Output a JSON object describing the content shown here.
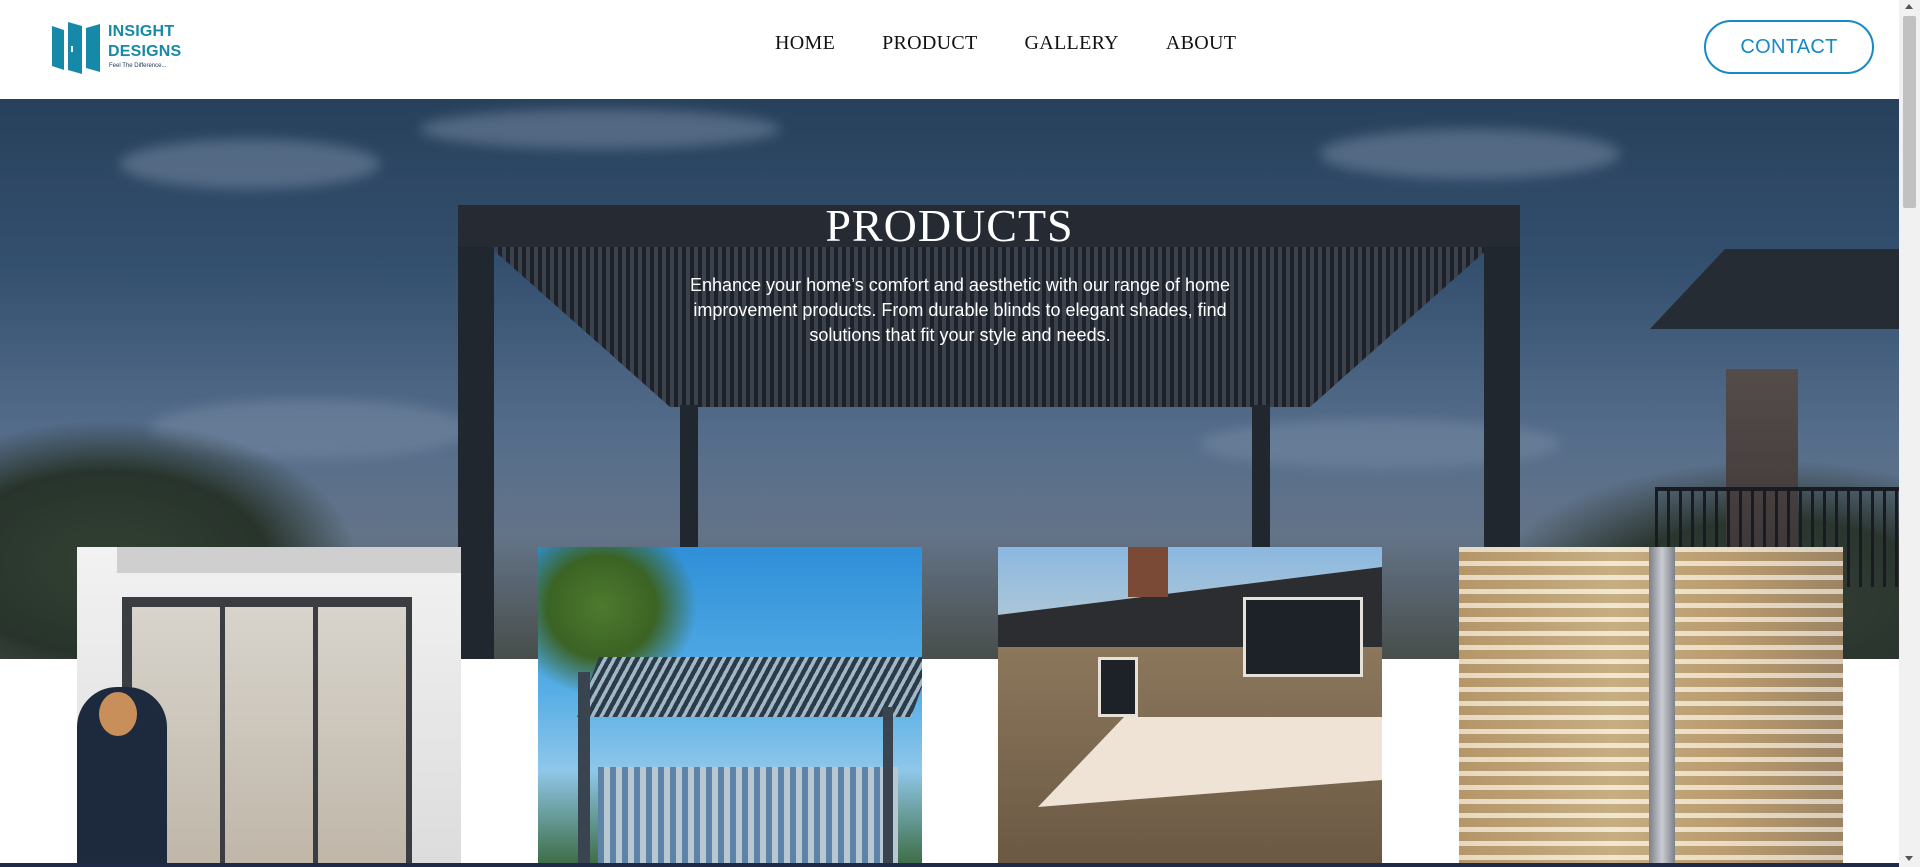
{
  "header": {
    "logo": {
      "line1": "INSIGHT",
      "line2": "DESIGNS",
      "tagline": "Feel The Difference..."
    },
    "nav": [
      {
        "label": "HOME"
      },
      {
        "label": "PRODUCT"
      },
      {
        "label": "GALLERY"
      },
      {
        "label": "ABOUT"
      }
    ],
    "contact_label": "CONTACT"
  },
  "hero": {
    "title": "PRODUCTS",
    "description": "Enhance your home’s comfort and aesthetic with our range of home improvement products. From durable blinds to elegant shades, find solutions that fit your style and needs."
  },
  "products": [
    {
      "image": "sliding-door-screen-image"
    },
    {
      "image": "louvred-pergola-image"
    },
    {
      "image": "retractable-awning-image"
    },
    {
      "image": "venetian-blinds-image"
    }
  ],
  "colors": {
    "brand": "#1789a8",
    "contact_border": "#1789c8",
    "nav_text": "#111111",
    "hero_text": "#ffffff"
  }
}
